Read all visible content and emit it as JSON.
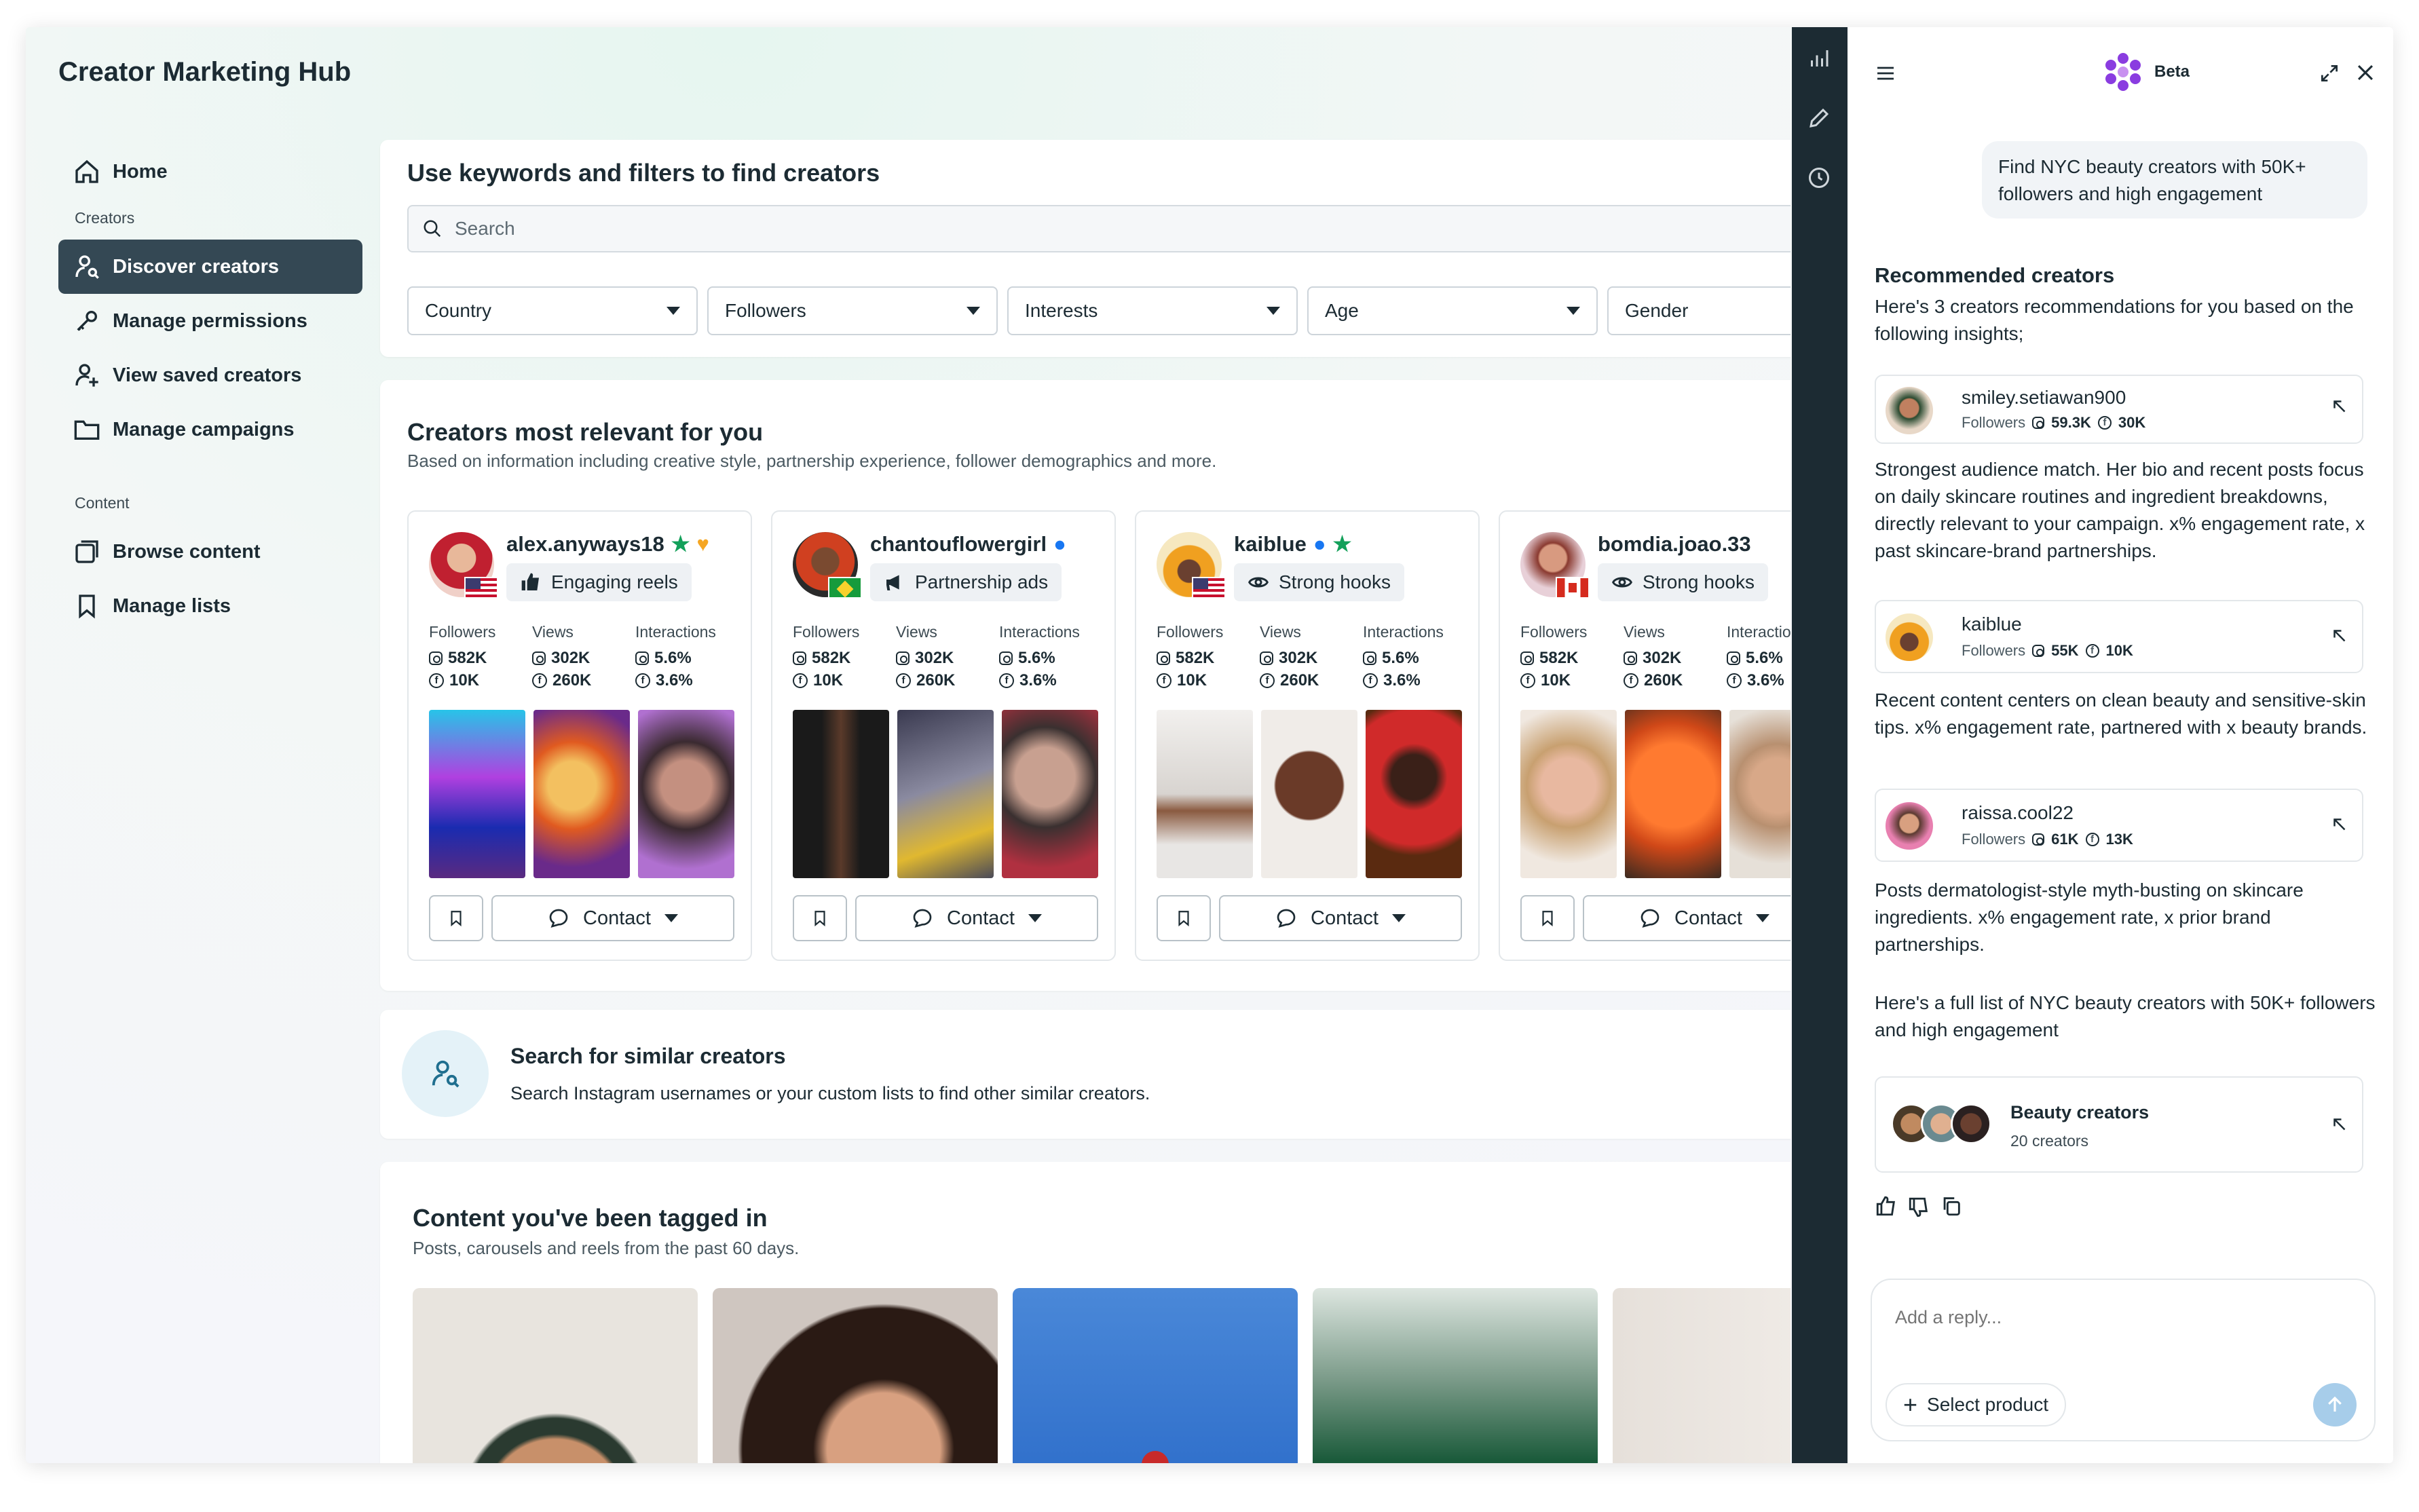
{
  "app": {
    "title": "Creator Marketing Hub"
  },
  "sidebar": {
    "home": "Home",
    "creators_section": "Creators",
    "creators_items": [
      "Discover creators",
      "Manage permissions",
      "View saved creators",
      "Manage campaigns"
    ],
    "content_section": "Content",
    "content_items": [
      "Browse content",
      "Manage lists"
    ]
  },
  "search_card": {
    "title": "Use keywords and filters to find creators",
    "placeholder": "Search",
    "filters": [
      "Country",
      "Followers",
      "Interests",
      "Age",
      "Gender"
    ]
  },
  "relevant": {
    "title": "Creators most relevant for you",
    "subtitle": "Based on information including creative style, partnership experience, follower demographics and more.",
    "stat_labels": [
      "Followers",
      "Views",
      "Interactions"
    ],
    "contact_label": "Contact",
    "creators": [
      {
        "username": "alex.anyways18",
        "badge": "Engaging reels",
        "followers": [
          "582K",
          "10K"
        ],
        "views": [
          "302K",
          "260K"
        ],
        "interactions": [
          "5.6%",
          "3.6%"
        ]
      },
      {
        "username": "chantouflowergirl",
        "badge": "Partnership ads",
        "followers": [
          "582K",
          "10K"
        ],
        "views": [
          "302K",
          "260K"
        ],
        "interactions": [
          "5.6%",
          "3.6%"
        ]
      },
      {
        "username": "kaiblue",
        "badge": "Strong hooks",
        "followers": [
          "582K",
          "10K"
        ],
        "views": [
          "302K",
          "260K"
        ],
        "interactions": [
          "5.6%",
          "3.6%"
        ]
      },
      {
        "username": "bomdia.joao.33",
        "badge": "Strong hooks",
        "followers": [
          "582K",
          "10K"
        ],
        "views": [
          "302K",
          "260K"
        ],
        "interactions": [
          "5.6%",
          "3.6%"
        ]
      }
    ]
  },
  "similar": {
    "title": "Search for similar creators",
    "subtitle": "Search Instagram usernames or your custom lists to find other similar creators."
  },
  "tagged": {
    "title": "Content you've been tagged in",
    "subtitle": "Posts, carousels and reels from the past 60 days."
  },
  "assistant": {
    "beta_label": "Beta",
    "user_message": "Find NYC beauty creators with 50K+ followers and high engagement",
    "heading": "Recommended creators",
    "intro": "Here's 3 creators recommendations for you based on the following insights;",
    "followers_label": "Followers",
    "recs": [
      {
        "username": "smiley.setiawan900",
        "ig": "59.3K",
        "fb": "30K",
        "insight": "Strongest audience match. Her bio and recent posts focus on daily skincare routines and ingredient breakdowns, directly relevant to your campaign. x% engagement rate, x past skincare-brand partnerships."
      },
      {
        "username": "kaiblue",
        "ig": "55K",
        "fb": "10K",
        "insight": "Recent content centers on clean beauty and sensitive-skin tips. x% engagement rate, partnered with x beauty brands."
      },
      {
        "username": "raissa.cool22",
        "ig": "61K",
        "fb": "13K",
        "insight": "Posts dermatologist-style myth-busting on skincare ingredients. x% engagement rate, x prior brand partnerships."
      }
    ],
    "full_list_text": "Here's a full list of NYC beauty creators with 50K+ followers and high engagement",
    "list_card": {
      "title": "Beauty creators",
      "count": "20 creators"
    },
    "reply_placeholder": "Add a reply...",
    "select_product": "Select product"
  },
  "colors": {
    "nav_active": "#344854",
    "strip": "#1c2b33",
    "verified": "#1877f2",
    "green_star": "#13a05a",
    "send_button": "#a7cdea"
  }
}
